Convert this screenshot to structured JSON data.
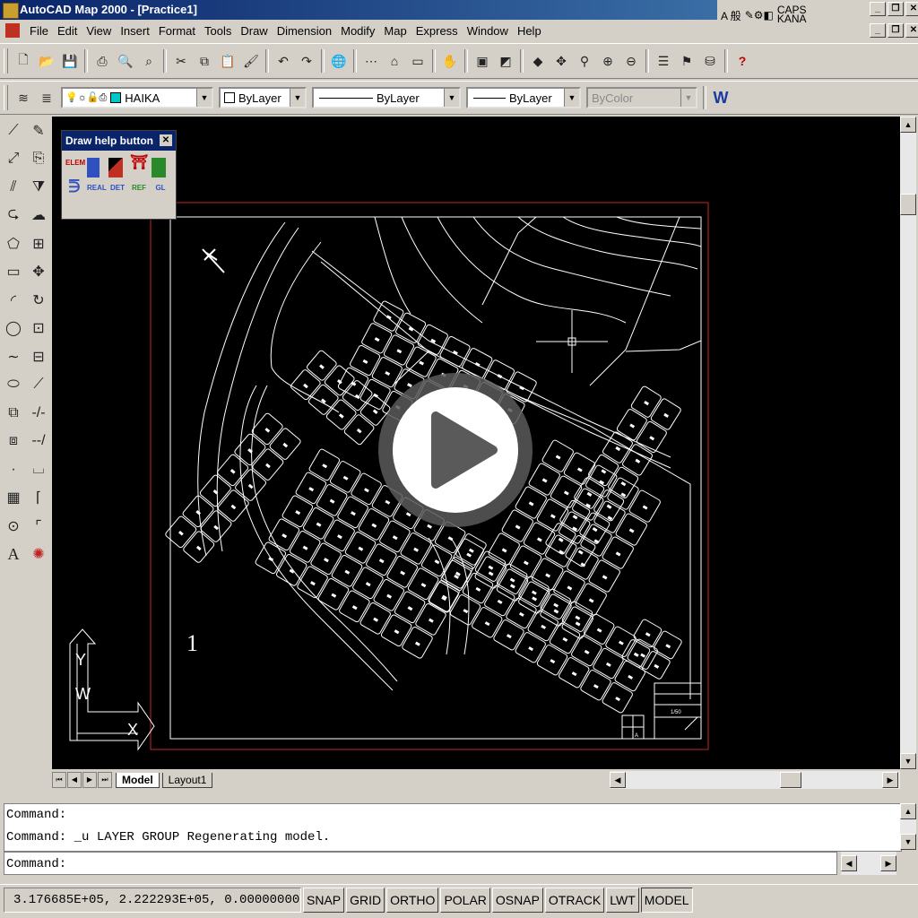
{
  "window": {
    "title": "AutoCAD Map 2000 - [Practice1]"
  },
  "ime": {
    "label": "A 般",
    "caps": "CAPS",
    "kana": "KANA"
  },
  "menu": [
    "File",
    "Edit",
    "View",
    "Insert",
    "Format",
    "Tools",
    "Draw",
    "Dimension",
    "Modify",
    "Map",
    "Express",
    "Window",
    "Help"
  ],
  "properties": {
    "layer": "HAIKA",
    "color": "ByLayer",
    "linetype": "ByLayer",
    "lineweight": "ByLayer",
    "plotstyle": "ByColor"
  },
  "palette": {
    "title": "Draw help button",
    "buttons": [
      "ELEM",
      "",
      "",
      "",
      "",
      "",
      "REAL",
      "DET",
      "REF",
      "GL"
    ]
  },
  "drawing": {
    "viewport_number": "1",
    "ucs_y": "Y",
    "ucs_w": "W",
    "ucs_x": "X",
    "titleblock": [
      "A",
      "1/50"
    ]
  },
  "tabs": {
    "model": "Model",
    "layout": "Layout1"
  },
  "command": {
    "history": [
      "Command:",
      "Command: _u LAYER GROUP Regenerating model."
    ],
    "prompt": "Command:"
  },
  "status": {
    "coords": "3.176685E+05, 2.222293E+05, 0.00000000",
    "buttons": [
      "SNAP",
      "GRID",
      "ORTHO",
      "POLAR",
      "OSNAP",
      "OTRACK",
      "LWT",
      "MODEL"
    ]
  },
  "colors": {
    "title_bar": "#0a246a",
    "canvas": "#000000",
    "layer_swatch": "#00c8c8"
  }
}
